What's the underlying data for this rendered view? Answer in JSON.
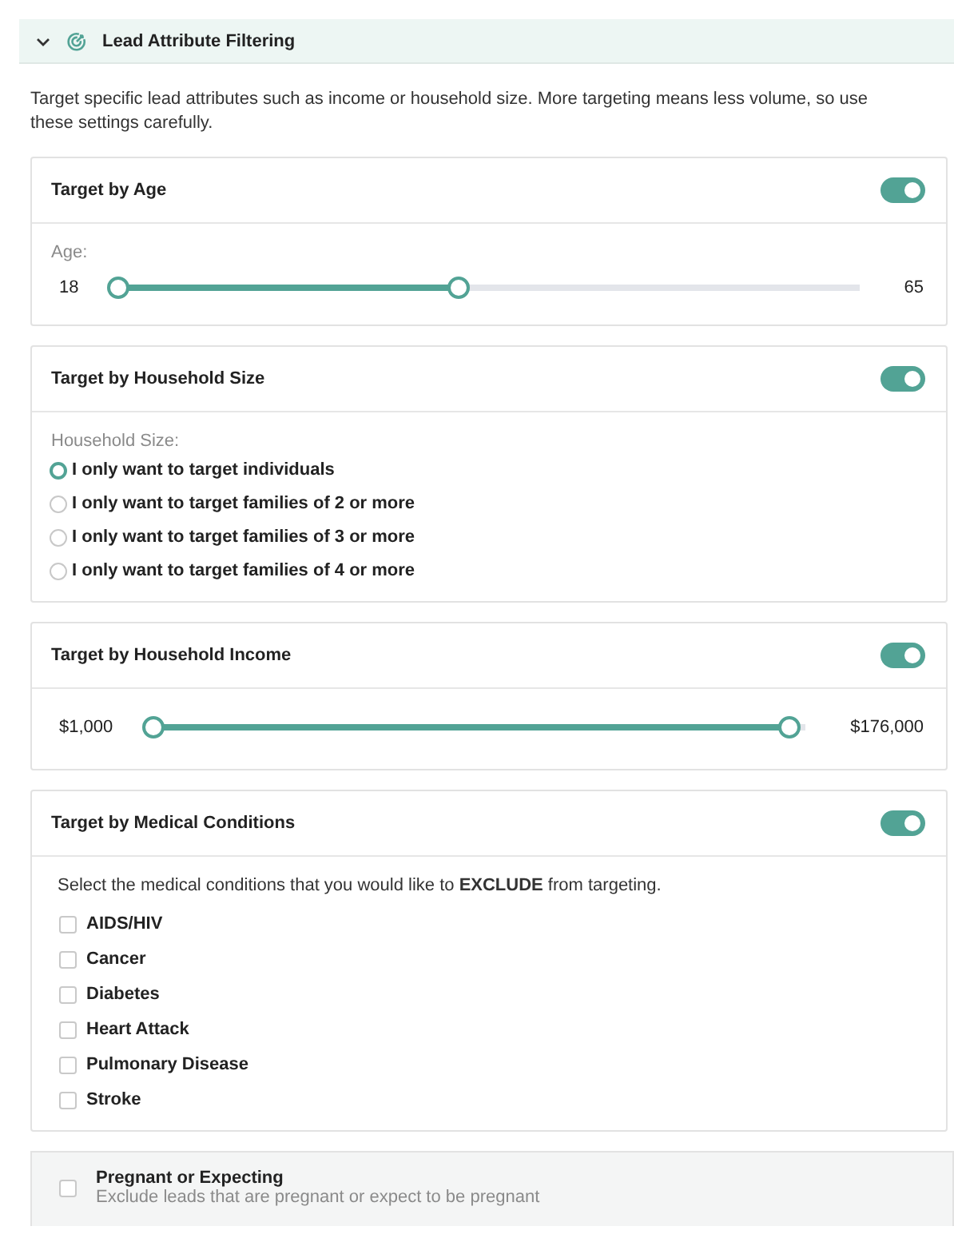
{
  "section": {
    "title": "Lead Attribute Filtering",
    "expanded": true
  },
  "description": "Target specific lead attributes such as income or household size. More targeting means less volume, so use these settings carefully.",
  "cards": [
    {
      "kind": "range",
      "title": "Target by Age",
      "enabled": true,
      "label": "Age:",
      "min_label": "18",
      "max_label": "65",
      "low": {
        "level": 0
      },
      "high": {
        "level": 0.46
      }
    },
    {
      "kind": "radio",
      "title": "Target by Household Size",
      "enabled": true,
      "label": "Household Size:",
      "options": [
        {
          "label": "I only want to target individuals",
          "selected": true
        },
        {
          "label": "I only want to target families of 2 or more",
          "selected": false
        },
        {
          "label": "I only want to target families of 3 or more",
          "selected": false
        },
        {
          "label": "I only want to target families of 4 or more",
          "selected": false
        }
      ]
    },
    {
      "kind": "range",
      "title": "Target by Household Income",
      "enabled": true,
      "min_label": "$1,000",
      "max_label": "$176,000",
      "low": {
        "level": 0
      },
      "high": {
        "level": 0.975
      }
    },
    {
      "kind": "checklist",
      "title": "Target by Medical Conditions",
      "enabled": true,
      "note": "Select the medical conditions that you would like to **EXCLUDE** from targeting.",
      "options": [
        {
          "label": "AIDS/HIV",
          "checked": false
        },
        {
          "label": "Cancer",
          "checked": false
        },
        {
          "label": "Diabetes",
          "checked": false
        },
        {
          "label": "Heart Attack",
          "checked": false
        },
        {
          "label": "Pulmonary Disease",
          "checked": false
        },
        {
          "label": "Stroke",
          "checked": false
        }
      ]
    }
  ],
  "extra": {
    "title": "Pregnant or Expecting",
    "subtitle": "Exclude leads that are pregnant or expect to be pregnant",
    "checked": false
  }
}
